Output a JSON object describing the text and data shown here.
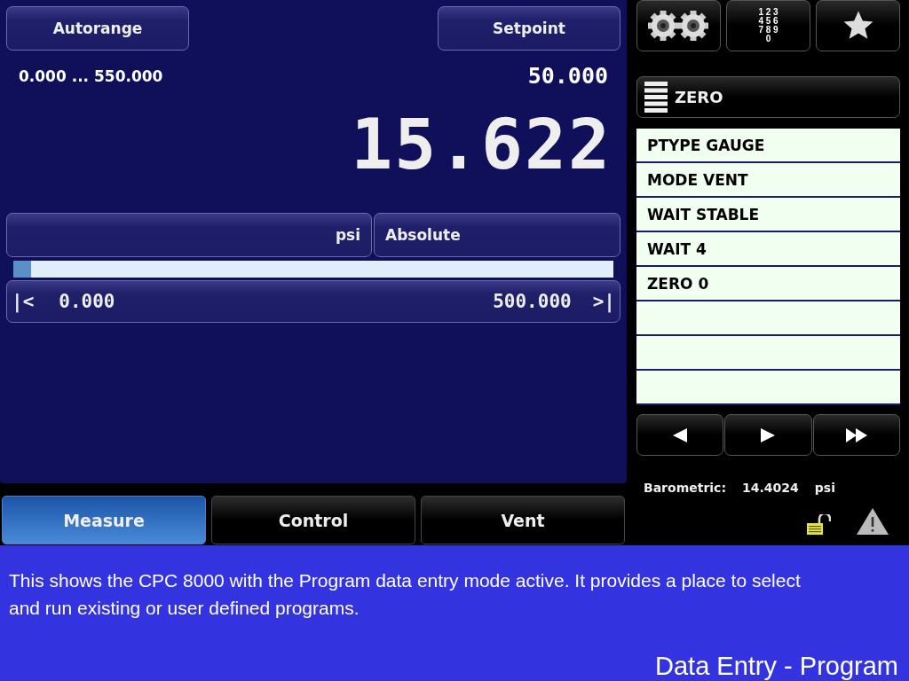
{
  "main_panel": {
    "autorange_button": "Autorange",
    "setpoint_button": "Setpoint",
    "range": "0.000 ... 550.000",
    "setpoint_value": "50.000",
    "reading": "15.622",
    "unit_button": "psi",
    "mode_button": "Absolute",
    "bar": {
      "level": 0.03
    },
    "scale_min_arrow": "|<",
    "scale_min": "0.000",
    "scale_max": "500.000",
    "scale_max_arrow": ">|"
  },
  "toolbar": {
    "keypad_lines": [
      "1 2 3",
      "4 5 6",
      "7 8 9",
      "0"
    ]
  },
  "program": {
    "title": "ZERO",
    "steps": [
      {
        "kind": "step",
        "text": "PTYPE GAUGE"
      },
      {
        "kind": "step",
        "text": "MODE VENT"
      },
      {
        "kind": "step",
        "text": "WAIT STABLE"
      },
      {
        "kind": "step",
        "text": "WAIT 4"
      },
      {
        "kind": "step",
        "text": "ZERO 0"
      },
      {
        "kind": "empty"
      },
      {
        "kind": "empty"
      },
      {
        "kind": "empty"
      }
    ]
  },
  "status": {
    "barometric_label": "Barometric:",
    "barometric_value": "14.4024",
    "barometric_unit": "psi",
    "locked": false
  },
  "tabs": [
    {
      "label": "Measure",
      "selected": true
    },
    {
      "label": "Control",
      "selected": false
    },
    {
      "label": "Vent",
      "selected": false
    }
  ],
  "caption": {
    "text": "This shows the CPC 8000 with the Program data entry mode active. It provides a place to select and run existing or user defined programs.",
    "title": "Data Entry - Program"
  }
}
